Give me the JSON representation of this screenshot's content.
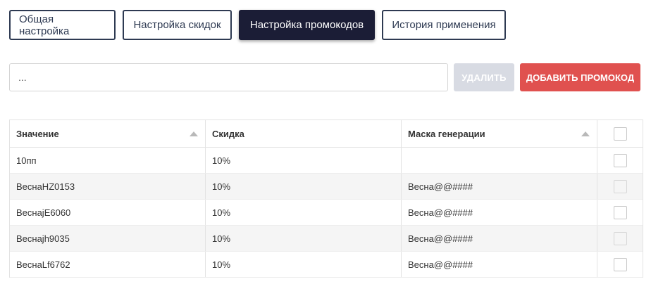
{
  "tabs": [
    {
      "label": "Общая настройка"
    },
    {
      "label": "Настройка скидок"
    },
    {
      "label": "Настройка промокодов"
    },
    {
      "label": "История применения"
    }
  ],
  "toolbar": {
    "search_value": "...",
    "delete_label": "УДАЛИТЬ",
    "add_label": "ДОБАВИТЬ ПРОМОКОД"
  },
  "table": {
    "headers": [
      "Значение",
      "Скидка",
      "Маска генерации"
    ],
    "rows": [
      {
        "value": "10пп",
        "discount": "10%",
        "mask": ""
      },
      {
        "value": "ВеснаHZ0153",
        "discount": "10%",
        "mask": "Весна@@####"
      },
      {
        "value": "ВеснаjE6060",
        "discount": "10%",
        "mask": "Весна@@####"
      },
      {
        "value": "Веснаjh9035",
        "discount": "10%",
        "mask": "Весна@@####"
      },
      {
        "value": "ВеснаLf6762",
        "discount": "10%",
        "mask": "Весна@@####"
      }
    ]
  },
  "colors": {
    "active_tab": "#1b1d36",
    "tab_border": "#2e3a52",
    "add_button": "#e0514f",
    "delete_button_disabled": "#d8dbe3"
  }
}
